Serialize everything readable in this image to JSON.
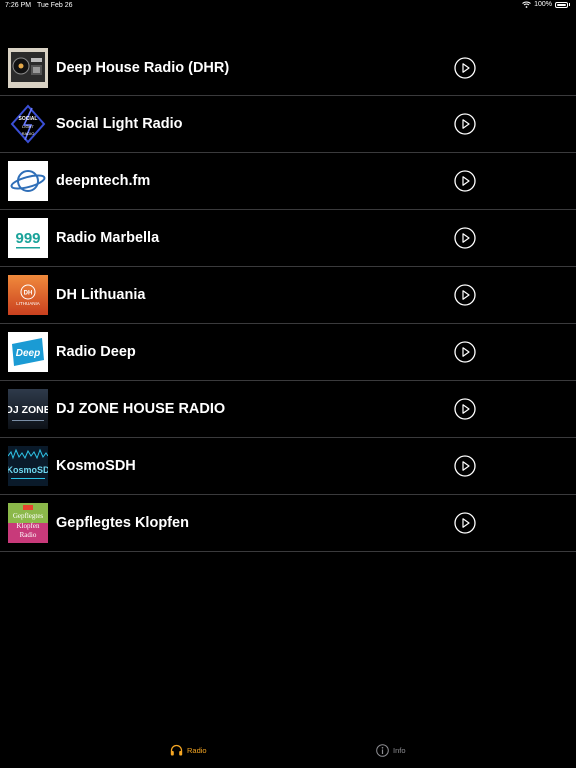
{
  "status": {
    "time": "7:26 PM",
    "date": "Tue Feb 26",
    "battery": "100%"
  },
  "stations": [
    {
      "name": "Deep House Radio (DHR)",
      "logo": "dhr-logo"
    },
    {
      "name": "Social Light Radio",
      "logo": "social-light-logo"
    },
    {
      "name": "deepntech.fm",
      "logo": "deepntech-logo"
    },
    {
      "name": "Radio Marbella",
      "logo": "radio-marbella-logo"
    },
    {
      "name": "DH Lithuania",
      "logo": "dh-lithuania-logo"
    },
    {
      "name": "Radio Deep",
      "logo": "radio-deep-logo"
    },
    {
      "name": "DJ ZONE HOUSE RADIO",
      "logo": "dj-zone-logo"
    },
    {
      "name": "KosmoSDH",
      "logo": "kosmosdh-logo"
    },
    {
      "name": "Gepflegtes Klopfen",
      "logo": "gepflegtes-klopfen-logo"
    }
  ],
  "logo_text": {
    "dj_zone": "DJ ZONE",
    "kosmo": "KosmoSD",
    "gepflegtes": "Gepflegtes Klopfen Radio",
    "dh": "DH",
    "lithuania": "LITHUANIA",
    "deep": "Deep",
    "social": "SOCIAL LIGHT RADIO",
    "marbella": "999"
  },
  "tabs": {
    "radio": "Radio",
    "info": "Info"
  },
  "colors": {
    "accent": "#f5a623",
    "inactive": "#8e8e93",
    "separator": "#3a3a3c"
  }
}
